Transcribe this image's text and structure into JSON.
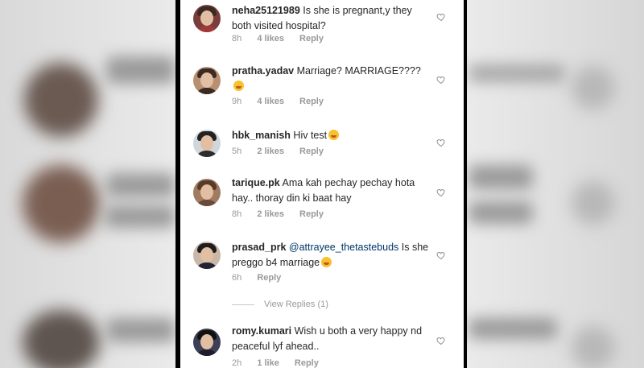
{
  "comments": [
    {
      "username": "neha25121989",
      "text": "Is she is pregnant,y they both visited hospital?",
      "time": "8h",
      "likes": "4 likes",
      "reply": "Reply",
      "emoji": false,
      "mention": ""
    },
    {
      "username": "pratha.yadav",
      "text": "Marriage? MARRIAGE????",
      "time": "9h",
      "likes": "4 likes",
      "reply": "Reply",
      "emoji": true,
      "mention": ""
    },
    {
      "username": "hbk_manish",
      "text": "Hiv test",
      "time": "5h",
      "likes": "2 likes",
      "reply": "Reply",
      "emoji": true,
      "mention": ""
    },
    {
      "username": "tarique.pk",
      "text": "Ama kah pechay pechay hota hay.. thoray din ki baat hay",
      "time": "8h",
      "likes": "2 likes",
      "reply": "Reply",
      "emoji": false,
      "mention": ""
    },
    {
      "username": "prasad_prk",
      "text": "Is she preggo b4 marriage",
      "time": "6h",
      "likes": "",
      "reply": "Reply",
      "emoji": true,
      "mention": "@attrayee_thetastebuds"
    },
    {
      "username": "romy.kumari",
      "text": "Wish u both a very happy nd peaceful lyf ahead..",
      "time": "2h",
      "likes": "1 like",
      "reply": "Reply",
      "emoji": false,
      "mention": ""
    }
  ],
  "view_replies": "View Replies (1)",
  "icons": {
    "like": "heart-outline-icon"
  },
  "colors": {
    "username": "#262626",
    "meta": "#999999",
    "mention": "#003569",
    "frame": "#000000"
  }
}
